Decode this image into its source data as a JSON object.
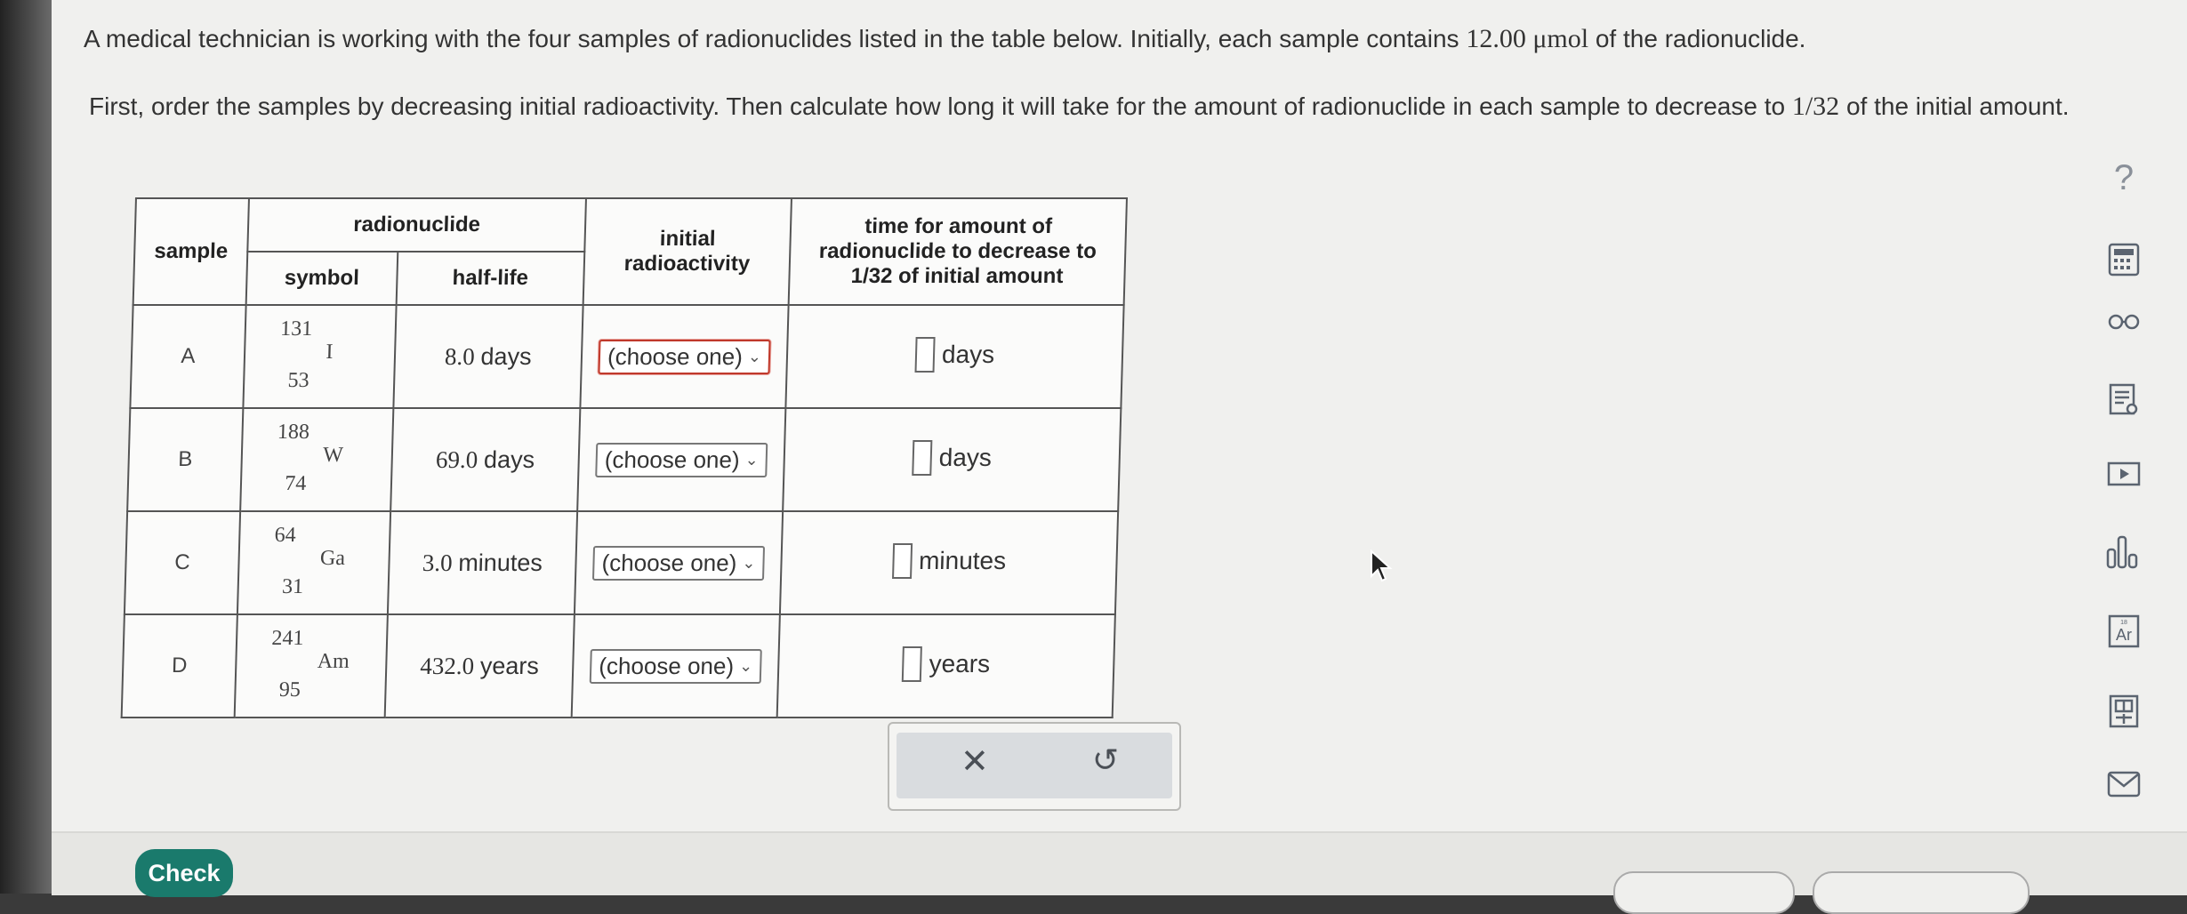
{
  "problem": {
    "intro_text": "A medical technician is working with the four samples of radionuclides listed in the table below. Initially, each sample contains ",
    "amount": "12.00 μmol",
    "intro_tail": " of the radionuclide.",
    "instruction_text": "First, order the samples by decreasing initial radioactivity. Then calculate how long it will take for the amount of radionuclide in each sample to decrease to ",
    "fraction": "1/32",
    "instruction_tail": " of the initial amount."
  },
  "table": {
    "headers": {
      "sample": "sample",
      "radionuclide": "radionuclide",
      "symbol": "symbol",
      "half_life": "half-life",
      "initial_radioactivity_1": "initial",
      "initial_radioactivity_2": "radioactivity",
      "time_1": "time for amount of",
      "time_2": "radionuclide to decrease to",
      "time_3": "1/32 of initial amount"
    },
    "rows": [
      {
        "sample": "A",
        "mass": "131",
        "atomic": "53",
        "element": "I",
        "half_life_value": "8.0",
        "half_life_unit": "days",
        "select": "(choose one)",
        "answer_unit": "days"
      },
      {
        "sample": "B",
        "mass": "188",
        "atomic": "74",
        "element": "W",
        "half_life_value": "69.0",
        "half_life_unit": "days",
        "select": "(choose one)",
        "answer_unit": "days"
      },
      {
        "sample": "C",
        "mass": "64",
        "atomic": "31",
        "element": "Ga",
        "half_life_value": "3.0",
        "half_life_unit": "minutes",
        "select": "(choose one)",
        "answer_unit": "minutes"
      },
      {
        "sample": "D",
        "mass": "241",
        "atomic": "95",
        "element": "Am",
        "half_life_value": "432.0",
        "half_life_unit": "years",
        "select": "(choose one)",
        "answer_unit": "years"
      }
    ]
  },
  "actions": {
    "clear_icon": "✕",
    "undo_icon": "↺"
  },
  "footer": {
    "check_label": "Check"
  },
  "toolbar": {
    "help": "?"
  },
  "colors": {
    "check_button": "#1a7a6c",
    "select_active_border": "#c0392b"
  }
}
